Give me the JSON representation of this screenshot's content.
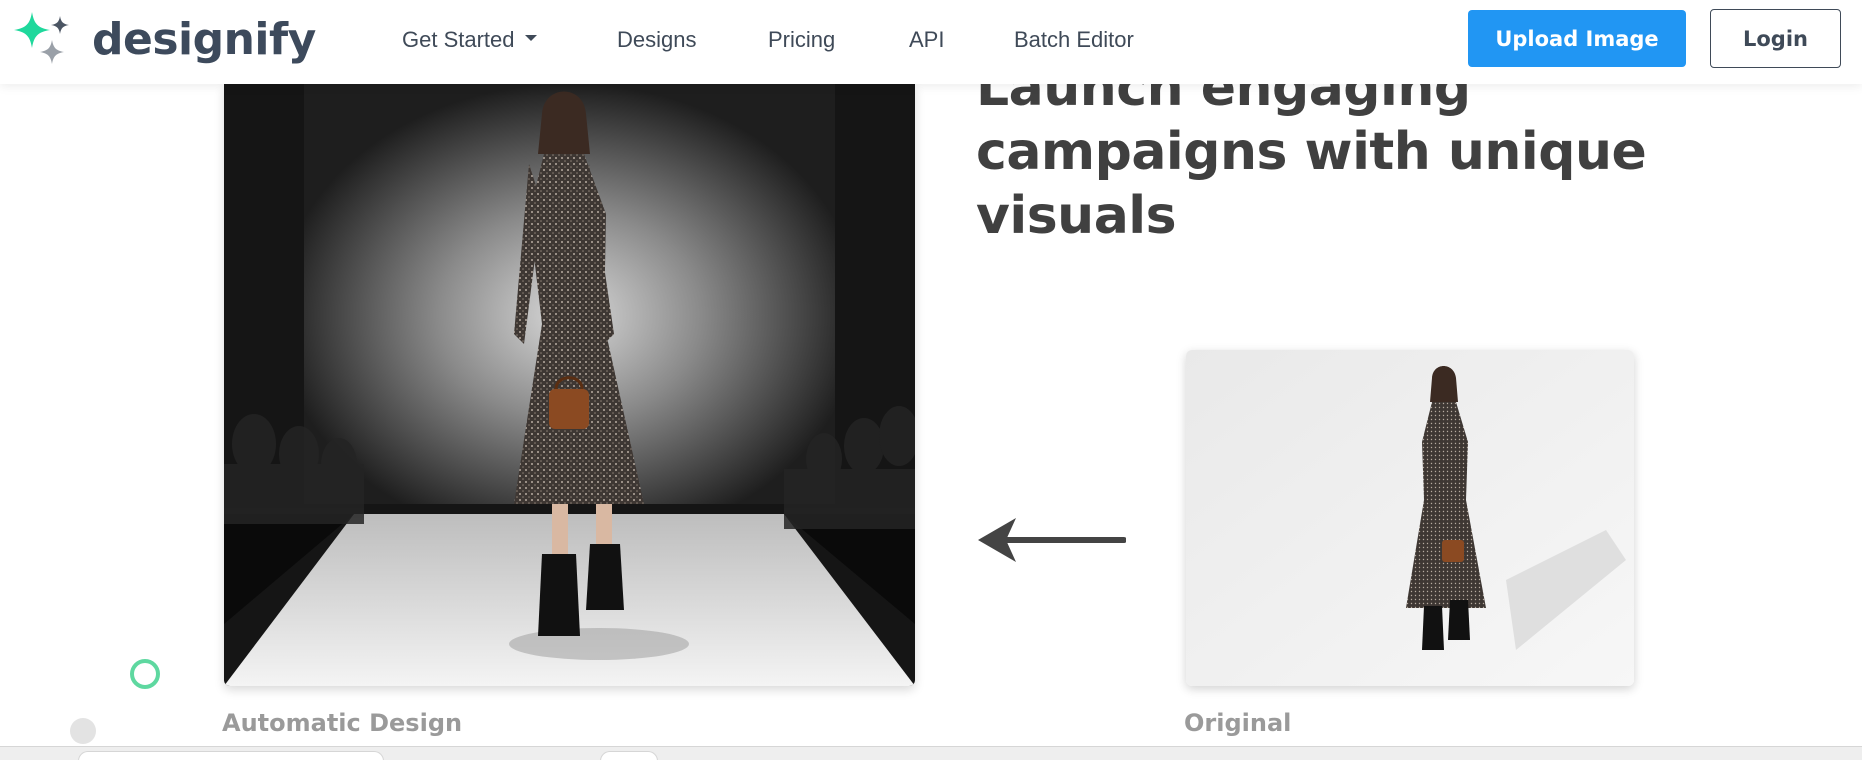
{
  "brand": {
    "name": "designify",
    "logo_icon": "sparkle-logo-icon",
    "colors": {
      "green": "#1fd89c",
      "gray": "#9aa0a8",
      "text": "#3d4a5c"
    }
  },
  "nav": {
    "items": [
      {
        "label": "Get Started",
        "has_dropdown": true
      },
      {
        "label": "Designs"
      },
      {
        "label": "Pricing"
      },
      {
        "label": "API"
      },
      {
        "label": "Batch Editor"
      }
    ]
  },
  "header_actions": {
    "upload_label": "Upload Image",
    "login_label": "Login",
    "accent": "#2196f3"
  },
  "hero": {
    "headline": "Launch engaging\ncampaigns with unique\nvisuals"
  },
  "comparison": {
    "result_caption": "Automatic Design",
    "original_caption": "Original",
    "arrow_icon": "arrow-left-icon"
  }
}
